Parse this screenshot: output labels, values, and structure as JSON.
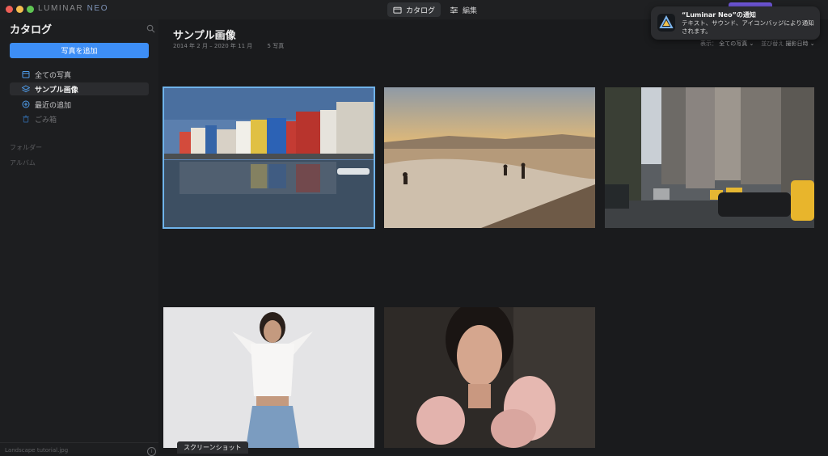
{
  "window": {
    "logo_prefix": "LUMINAR",
    "logo_suffix": "NEO",
    "modes": [
      {
        "label": "カタログ",
        "icon": "folder-icon",
        "active": true
      },
      {
        "label": "編集",
        "icon": "sliders-icon",
        "active": false
      }
    ]
  },
  "sidebar": {
    "title": "カタログ",
    "add_button": "写真を追加",
    "items": [
      {
        "label": "全ての写真",
        "icon": "calendar-icon"
      },
      {
        "label": "サンプル画像",
        "icon": "layers-icon"
      },
      {
        "label": "最近の追加",
        "icon": "plus-circle-icon"
      },
      {
        "label": "ごみ箱",
        "icon": "trash-icon"
      }
    ],
    "sections": [
      "フォルダー",
      "アルバム"
    ],
    "current_file": "Landscape tutorial.jpg"
  },
  "album": {
    "title": "サンプル画像",
    "date_range": "2014 年 2 月 – 2020 年 11 月",
    "photo_count": "5 写真"
  },
  "viewbar": {
    "show_label": "表示：",
    "show_value": "全ての写真 ⌄",
    "sort_label": "並び替え",
    "sort_value": "撮影日時 ⌄"
  },
  "photos": [
    {
      "subject": "colorful-houses-canal",
      "selected": true
    },
    {
      "subject": "beach-sunset-swimmers",
      "selected": false
    },
    {
      "subject": "city-street-taxis",
      "selected": false
    },
    {
      "subject": "woman-white-blouse",
      "selected": false
    },
    {
      "subject": "woman-pink-ruffles",
      "selected": false
    }
  ],
  "tooltip": "スクリーンショット",
  "notification": {
    "title": "“Luminar Neo”の通知",
    "body": "テキスト、サウンド、アイコンバッジにより通知されます。"
  },
  "colors": {
    "accent": "#3d8ef6",
    "selection": "#6fb3ea"
  }
}
